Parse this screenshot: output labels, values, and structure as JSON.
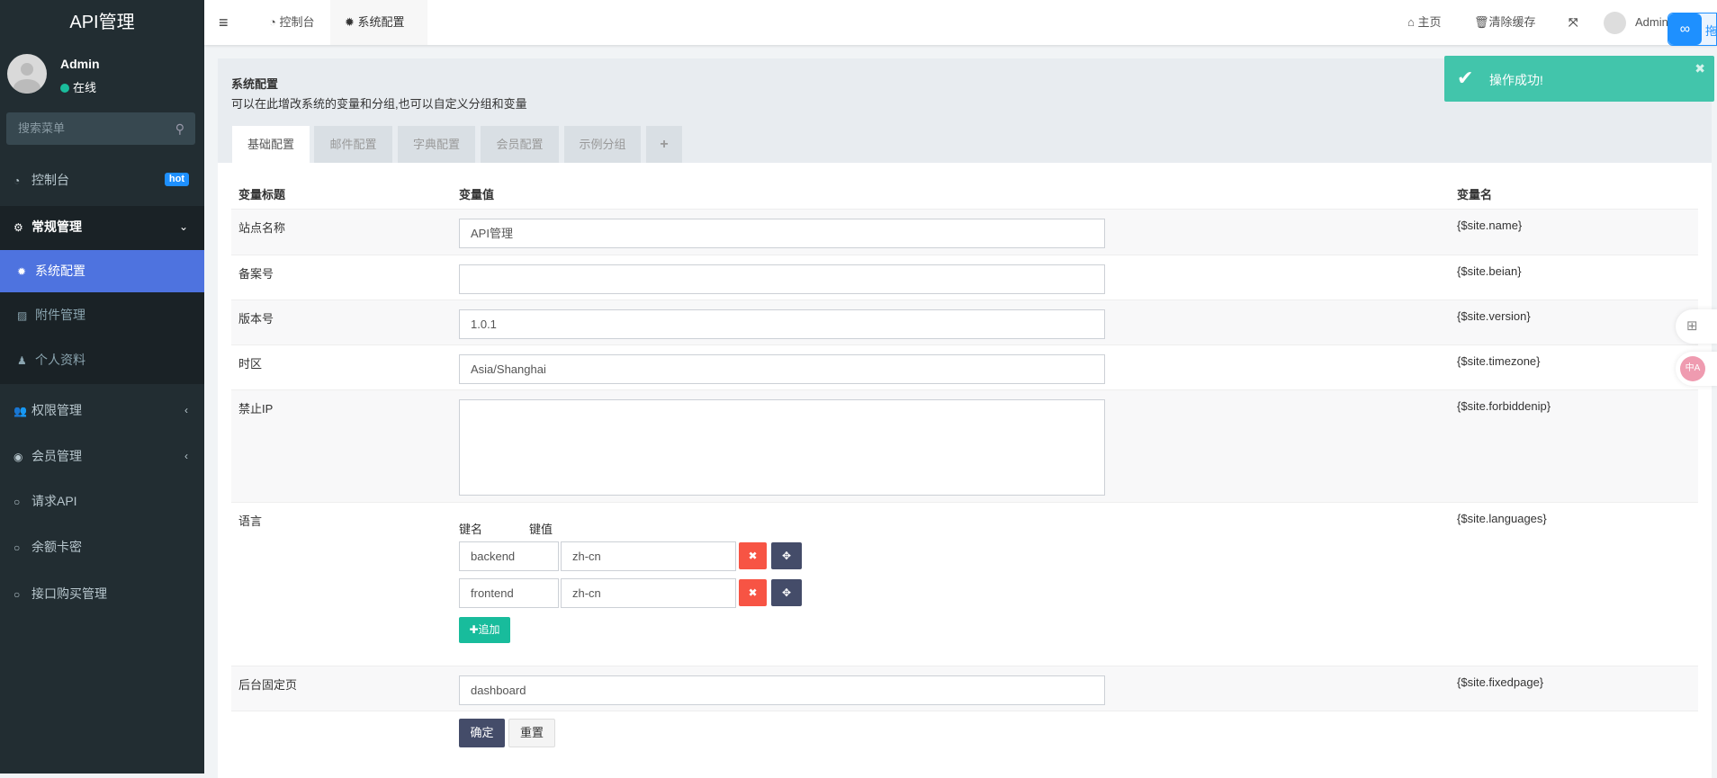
{
  "app": {
    "title": "API管理"
  },
  "user": {
    "name": "Admin",
    "status": "在线"
  },
  "search": {
    "placeholder": "搜索菜单"
  },
  "sidebar": {
    "items": [
      {
        "label": "控制台",
        "icon": "dashboard-icon",
        "badge": "hot"
      },
      {
        "label": "常规管理",
        "icon": "cogs-icon",
        "expanded": true,
        "children": [
          {
            "label": "系统配置",
            "icon": "gear-icon",
            "active": true
          },
          {
            "label": "附件管理",
            "icon": "image-icon"
          },
          {
            "label": "个人资料",
            "icon": "user-icon"
          }
        ]
      },
      {
        "label": "权限管理",
        "icon": "group-icon"
      },
      {
        "label": "会员管理",
        "icon": "user-circle-icon"
      },
      {
        "label": "请求API",
        "icon": "circle-icon"
      },
      {
        "label": "余额卡密",
        "icon": "circle-icon"
      },
      {
        "label": "接口购买管理",
        "icon": "circle-icon"
      }
    ]
  },
  "header": {
    "tabs": [
      {
        "label": "控制台"
      },
      {
        "label": "系统配置",
        "active": true
      }
    ],
    "home": "主页",
    "clear_cache": "清除缓存",
    "user": "Admin",
    "widget_text": "拖"
  },
  "page": {
    "title": "系统配置",
    "subtitle": "可以在此增改系统的变量和分组,也可以自定义分组和变量",
    "tabs": [
      "基础配置",
      "邮件配置",
      "字典配置",
      "会员配置",
      "示例分组",
      "+"
    ],
    "active_tab": "基础配置"
  },
  "table": {
    "headers": [
      "变量标题",
      "变量值",
      "变量名"
    ],
    "rows": [
      {
        "title": "站点名称",
        "value": "API管理",
        "var": "{$site.name}"
      },
      {
        "title": "备案号",
        "value": "",
        "var": "{$site.beian}"
      },
      {
        "title": "版本号",
        "value": "1.0.1",
        "var": "{$site.version}"
      },
      {
        "title": "时区",
        "value": "Asia/Shanghai",
        "var": "{$site.timezone}"
      },
      {
        "title": "禁止IP",
        "value": "",
        "var": "{$site.forbiddenip}"
      },
      {
        "title": "语言",
        "var": "{$site.languages}",
        "key_label": "键名",
        "val_label": "键值",
        "pairs": [
          {
            "key": "backend",
            "value": "zh-cn"
          },
          {
            "key": "frontend",
            "value": "zh-cn"
          }
        ],
        "add_label": "追加"
      },
      {
        "title": "后台固定页",
        "value": "dashboard",
        "var": "{$site.fixedpage}"
      }
    ]
  },
  "actions": {
    "submit": "确定",
    "reset": "重置"
  },
  "toast": {
    "message": "操作成功!"
  },
  "colors": {
    "sidebar": "#222d32",
    "active": "#4e73df",
    "toast": "#42c5ab",
    "danger": "#f75444",
    "dark": "#444c69",
    "success": "#18bc9c"
  }
}
